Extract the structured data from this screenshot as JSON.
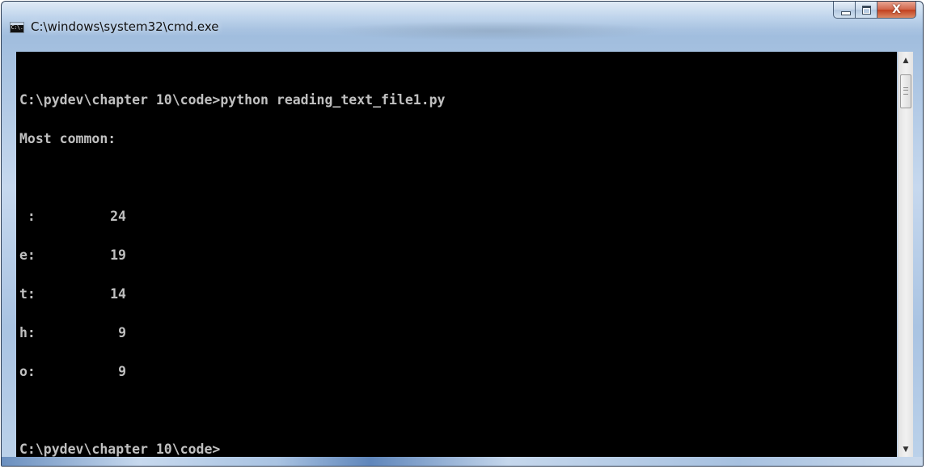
{
  "window": {
    "title": "C:\\windows\\system32\\cmd.exe",
    "icon": "cmd-icon",
    "icon_text": "C:\\."
  },
  "caption_buttons": {
    "minimize_icon": "minimize-icon",
    "maximize_icon": "maximize-icon",
    "close_label": "X"
  },
  "console": {
    "background": "#000000",
    "foreground": "#c0c0c0",
    "command_line": "C:\\pydev\\chapter 10\\code>python reading_text_file1.py",
    "heading": "Most common:",
    "rows": [
      {
        "char": " :",
        "count": "24"
      },
      {
        "char": "e:",
        "count": "19"
      },
      {
        "char": "t:",
        "count": "14"
      },
      {
        "char": "h:",
        "count": "9"
      },
      {
        "char": "o:",
        "count": "9"
      }
    ],
    "prompt": "C:\\pydev\\chapter 10\\code>"
  },
  "scrollbar": {
    "up_arrow": "▲",
    "down_arrow": "▼"
  }
}
